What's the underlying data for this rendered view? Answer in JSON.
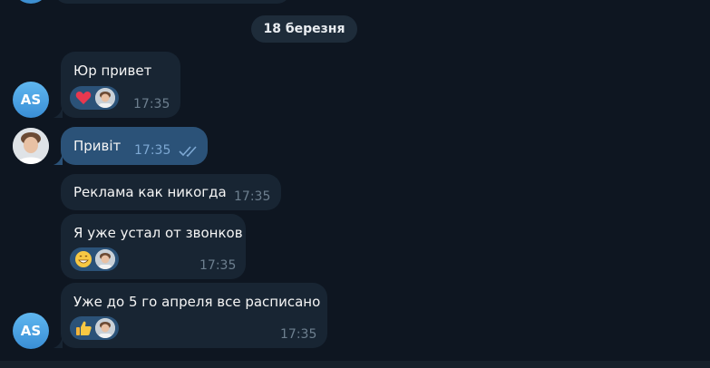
{
  "date_separator": "18 березня",
  "avatars": {
    "sender_initials": "AS"
  },
  "messages": [
    {
      "text": "Юр привет",
      "time": "17:35",
      "reaction": "heart"
    },
    {
      "text": "Привіт",
      "time": "17:35",
      "status": "read"
    },
    {
      "text": "Реклама как никогда",
      "time": "17:35"
    },
    {
      "text": "Я уже устал от звонков",
      "time": "17:35",
      "reaction": "grinning"
    },
    {
      "text": "Уже до 5 го апреля все расписано",
      "time": "17:35",
      "reaction": "thumbs-up"
    }
  ],
  "colors": {
    "background": "#0e1621",
    "incoming_bubble": "#182533",
    "outgoing_bubble": "#2b5278",
    "avatar_blue": "#3a8fd6",
    "time_text": "#6d7f8f",
    "read_check": "#7da8d3"
  }
}
